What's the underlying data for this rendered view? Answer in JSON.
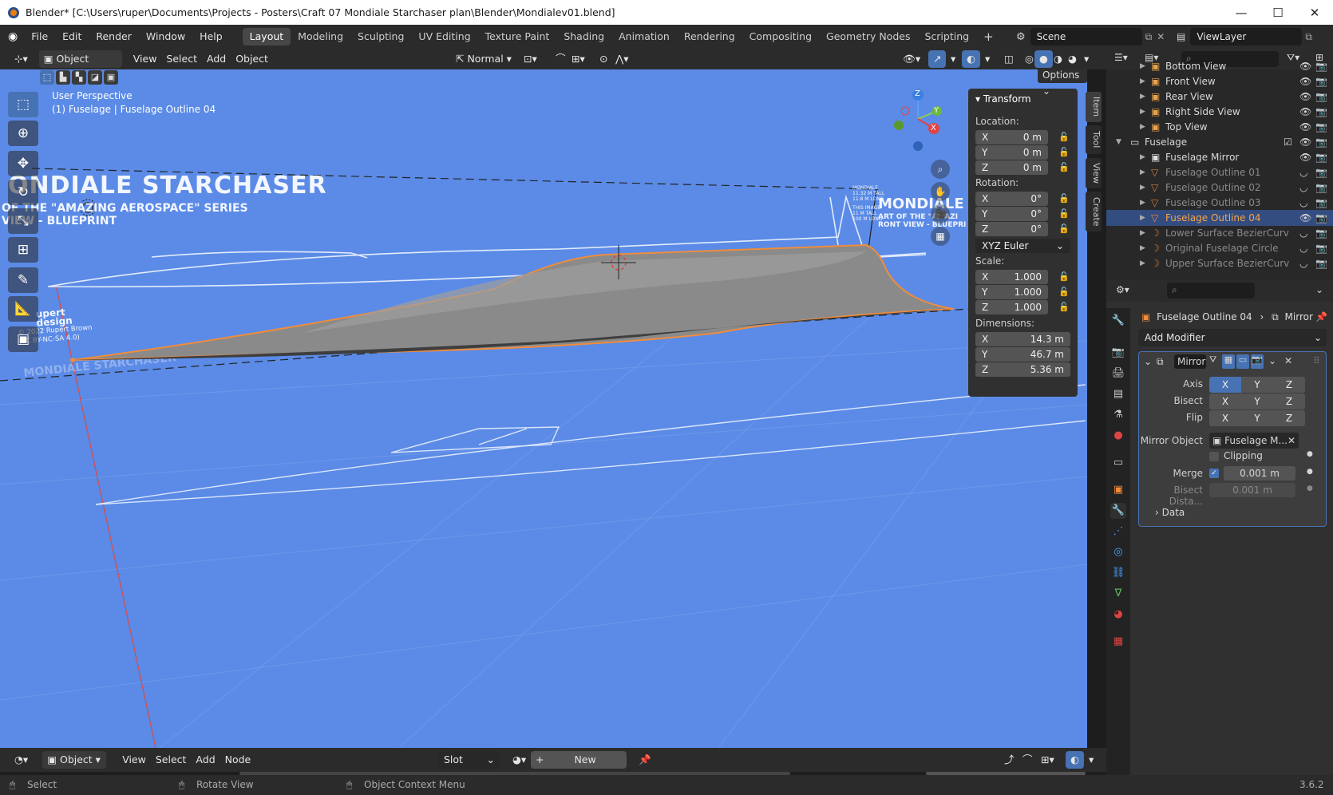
{
  "window": {
    "title": "Blender* [C:\\Users\\ruper\\Documents\\Projects - Posters\\Craft 07 Mondiale Starchaser plan\\Blender\\Mondialev01.blend]",
    "minimize": "—",
    "maximize": "☐",
    "close": "✕"
  },
  "menu": [
    "File",
    "Edit",
    "Render",
    "Window",
    "Help"
  ],
  "workspaces": [
    "Layout",
    "Modeling",
    "Sculpting",
    "UV Editing",
    "Texture Paint",
    "Shading",
    "Animation",
    "Rendering",
    "Compositing",
    "Geometry Nodes",
    "Scripting"
  ],
  "active_workspace": "Layout",
  "scene": "Scene",
  "view_layer": "ViewLayer",
  "viewport_header": {
    "mode": "Object Mode",
    "menus": [
      "View",
      "Select",
      "Add",
      "Object"
    ],
    "orientation": "Normal",
    "options": "Options"
  },
  "viewport": {
    "perspective": "User Perspective",
    "object_info": "(1) Fuselage | Fuselage Outline 04",
    "blueprint_title": "ONDIALE STARCHASER",
    "blueprint_sub1": "OF THE \"AMAZING AEROSPACE\" SERIES",
    "blueprint_sub2": "VIEW - BLUEPRINT",
    "blueprint_right_title": "MONDIALE ST",
    "blueprint_right_sub1": "ART OF THE \"AMAZI",
    "blueprint_right_sub2": "RONT VIEW - BLUEPRI",
    "credit1": "upert",
    "credit2": "design",
    "credit3": "© 2022 Rupert Brown",
    "credit4": "(CC BY-NC-SA 4.0)",
    "spec1": "MONDIALE",
    "spec2": "11.32 M TALL",
    "spec3": "11.8 M LONG",
    "spec4": "THIS IMAGE",
    "spec5": "11 M TALL",
    "spec6": "100 M LONG",
    "gizmo_x": "X",
    "gizmo_y": "Y",
    "gizmo_z": "Z"
  },
  "transform": {
    "header": "Transform",
    "location_label": "Location:",
    "location": [
      {
        "axis": "X",
        "value": "0 m"
      },
      {
        "axis": "Y",
        "value": "0 m"
      },
      {
        "axis": "Z",
        "value": "0 m"
      }
    ],
    "rotation_label": "Rotation:",
    "rotation": [
      {
        "axis": "X",
        "value": "0°"
      },
      {
        "axis": "Y",
        "value": "0°"
      },
      {
        "axis": "Z",
        "value": "0°"
      }
    ],
    "rotation_mode": "XYZ Euler",
    "scale_label": "Scale:",
    "scale": [
      {
        "axis": "X",
        "value": "1.000"
      },
      {
        "axis": "Y",
        "value": "1.000"
      },
      {
        "axis": "Z",
        "value": "1.000"
      }
    ],
    "dimensions_label": "Dimensions:",
    "dimensions": [
      {
        "axis": "X",
        "value": "14.3 m"
      },
      {
        "axis": "Y",
        "value": "46.7 m"
      },
      {
        "axis": "Z",
        "value": "5.36 m"
      }
    ]
  },
  "side_tabs": [
    "Item",
    "Tool",
    "View",
    "Create"
  ],
  "outliner": {
    "rows": [
      {
        "label": "Bottom View",
        "dim": false
      },
      {
        "label": "Front View",
        "dim": false
      },
      {
        "label": "Rear View",
        "dim": false
      },
      {
        "label": "Right Side View",
        "dim": false
      },
      {
        "label": "Top View",
        "dim": false
      },
      {
        "label": "Fuselage",
        "dim": false
      },
      {
        "label": "Fuselage Mirror",
        "dim": false
      },
      {
        "label": "Fuselage Outline 01",
        "dim": true
      },
      {
        "label": "Fuselage Outline 02",
        "dim": true
      },
      {
        "label": "Fuselage Outline 03",
        "dim": true
      },
      {
        "label": "Fuselage Outline 04",
        "dim": false,
        "selected": true
      },
      {
        "label": "Lower Surface BezierCurv",
        "dim": true
      },
      {
        "label": "Original Fuselage Circle",
        "dim": true
      },
      {
        "label": "Upper Surface BezierCurv",
        "dim": true
      }
    ]
  },
  "properties": {
    "breadcrumb_object": "Fuselage Outline 04",
    "breadcrumb_modifier": "Mirror",
    "add_modifier": "Add Modifier",
    "modifier_name": "Mirror",
    "axis_label": "Axis",
    "bisect_label": "Bisect",
    "flip_label": "Flip",
    "x": "X",
    "y": "Y",
    "z": "Z",
    "mirror_object_label": "Mirror Object",
    "mirror_object": "Fuselage M...",
    "clipping_label": "Clipping",
    "merge_label": "Merge",
    "merge_value": "0.001 m",
    "bisect_distance_label": "Bisect Dista...",
    "bisect_distance_value": "0.001 m",
    "data_label": "Data"
  },
  "timeline": {
    "mode": "Object",
    "menus": [
      "View",
      "Select",
      "Add",
      "Node"
    ],
    "slot": "Slot",
    "new_label": "New"
  },
  "status": {
    "select": "Select",
    "rotate": "Rotate View",
    "context": "Object Context Menu",
    "version": "3.6.2"
  },
  "colors": {
    "accent": "#4772b3",
    "viewport_bg": "#5b8be6",
    "selection_outline": "#f08c3c",
    "outliner_select": "#334d80"
  }
}
